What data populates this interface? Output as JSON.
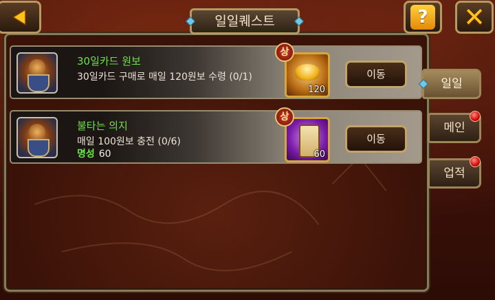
{
  "header": {
    "title": "일일퀘스트",
    "back_icon": "back-arrow-icon",
    "help_label": "?",
    "close_label": "✕"
  },
  "quests": [
    {
      "title": "30일카드 원보",
      "description": "30일카드 구매로 매일 120원보 수령 (0/1)",
      "rank": "상",
      "reward_qty": "120",
      "reward_icon": "gold-ingot-icon",
      "button": "이동"
    },
    {
      "title": "불타는 의지",
      "description": "매일 100원보 충전 (0/6)",
      "extra_label": "명성",
      "extra_value": "60",
      "rank": "상",
      "reward_qty": "60",
      "reward_icon": "scroll-icon",
      "button": "이동"
    }
  ],
  "tabs": [
    {
      "label": "일일",
      "active": true,
      "alert": false
    },
    {
      "label": "메인",
      "active": false,
      "alert": true
    },
    {
      "label": "업적",
      "active": false,
      "alert": true
    }
  ],
  "colors": {
    "quest_title": "#6fe24a",
    "gold_border": "#d9a63a",
    "alert_red": "#d10a0a"
  }
}
